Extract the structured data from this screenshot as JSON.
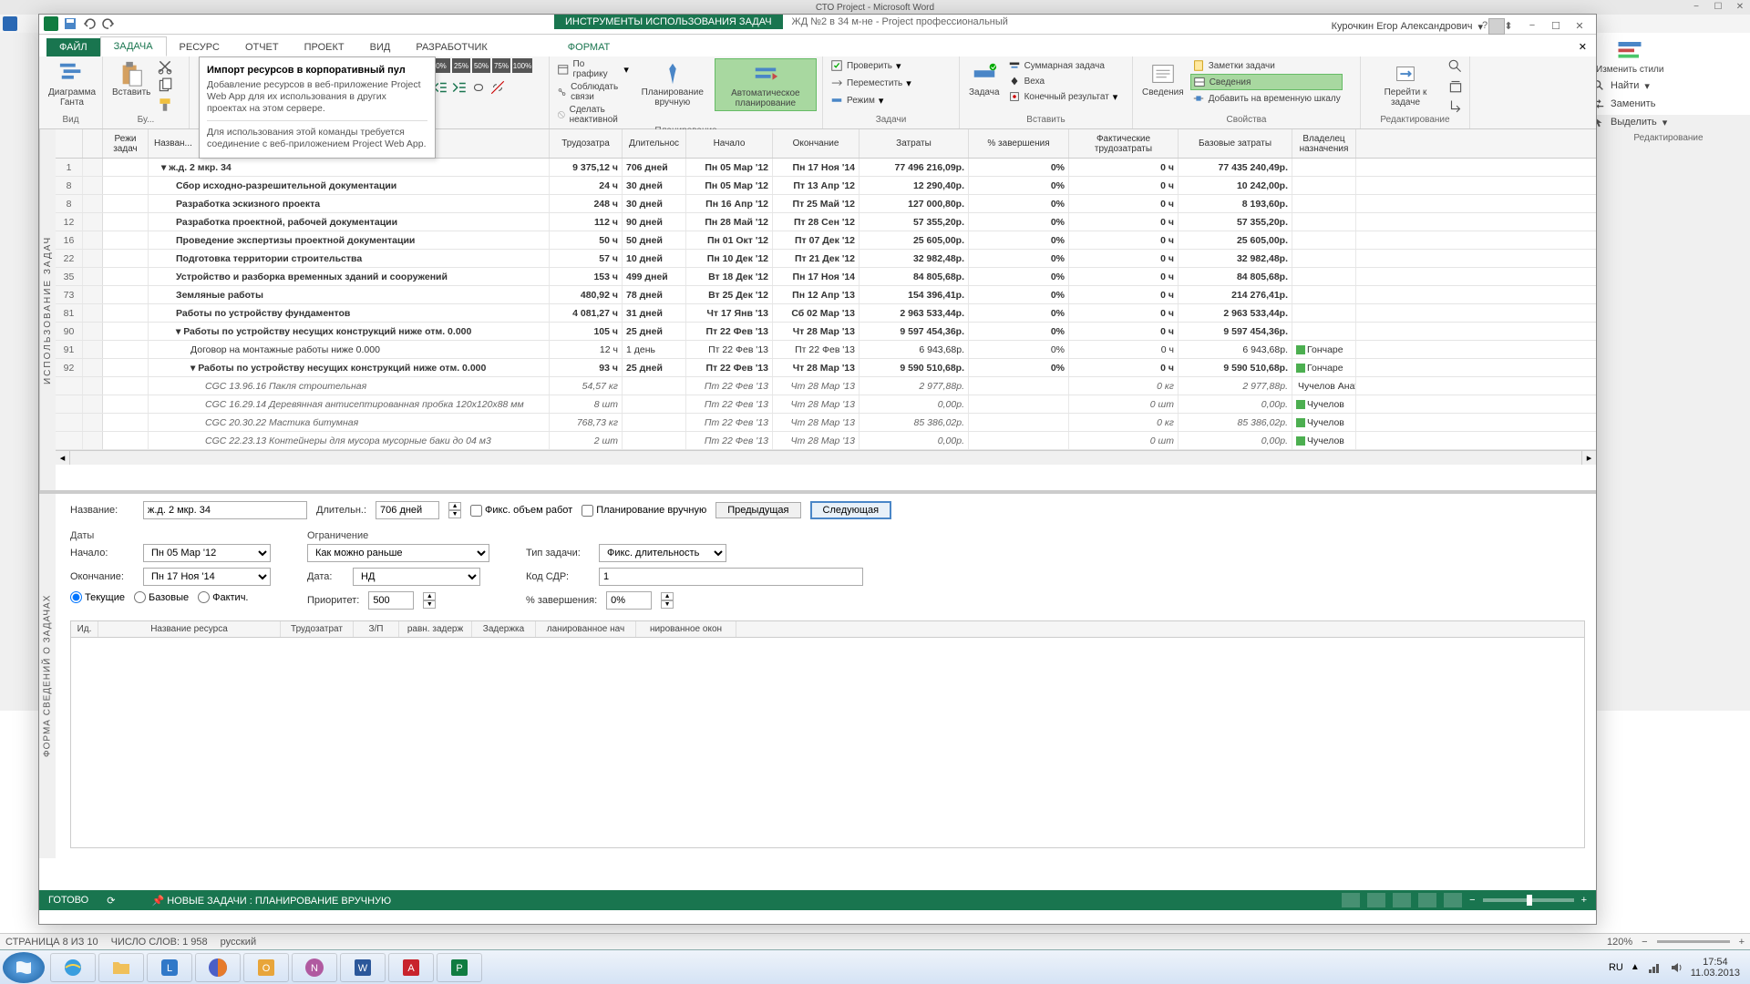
{
  "word": {
    "title": "СТО Project - Microsoft Word",
    "rail": {
      "find": "Найти",
      "replace": "Заменить",
      "select": "Выделить",
      "changeStyles": "Изменить стили",
      "group": "Редактирование"
    },
    "status": {
      "page": "СТРАНИЦА 8 ИЗ 10",
      "words": "ЧИСЛО СЛОВ: 1 958",
      "lang": "русский",
      "zoom": "120%"
    }
  },
  "project": {
    "toolTab": "ИНСТРУМЕНТЫ ИСПОЛЬЗОВАНИЯ ЗАДАЧ",
    "docTitle": "ЖД №2 в 34 м-не - Project профессиональный",
    "user": "Курочкин Егор Александрович",
    "tabs": {
      "file": "ФАЙЛ",
      "task": "ЗАДАЧА",
      "resource": "РЕСУРС",
      "report": "ОТЧЕТ",
      "projectTab": "ПРОЕКТ",
      "view": "ВИД",
      "developer": "РАЗРАБОТЧИК",
      "format": "ФОРМАТ"
    },
    "ribbon": {
      "view": {
        "gantt": "Диаграмма Ганта",
        "label": "Вид"
      },
      "clipboard": {
        "paste": "Вставить",
        "label": "Бу..."
      },
      "tooltip": {
        "title": "Импорт ресурсов в корпоративный пул",
        "body1": "Добавление ресурсов в веб-приложение Project Web App для их использования в других проектах на этом сервере.",
        "body2": "Для использования этой команды требуется соединение с веб-приложением Project Web App."
      },
      "percent": {
        "0": "0%",
        "25": "25%",
        "50": "50%",
        "75": "75%",
        "100": "100%"
      },
      "schedule": {
        "onTrack": "По графику",
        "respectLinks": "Соблюдать связи",
        "makeInactive": "Сделать неактивной",
        "label": "Планирование",
        "manual": "Планирование вручную",
        "auto": "Автоматическое планирование"
      },
      "tasks": {
        "inspect": "Проверить",
        "move": "Переместить",
        "mode": "Режим",
        "label": "Задачи",
        "task": "Задача"
      },
      "insert": {
        "summary": "Суммарная задача",
        "milestone": "Веха",
        "deliverable": "Конечный результат",
        "label": "Вставить"
      },
      "props": {
        "info": "Сведения",
        "notes": "Заметки задачи",
        "details": "Сведения",
        "timeline": "Добавить на временную шкалу",
        "label": "Свойства"
      },
      "edit": {
        "goto": "Перейти к задаче",
        "label": "Редактирование"
      }
    },
    "columns": {
      "rowMode": "Режи задач",
      "name": "Назван...",
      "work": "Трудозатра",
      "duration": "Длительнос",
      "start": "Начало",
      "finish": "Окончание",
      "cost": "Затраты",
      "pctComplete": "% завершения",
      "actualWork": "Фактические трудозатраты",
      "baselineCost": "Базовые затраты",
      "owner": "Владелец назначения"
    },
    "rows": [
      {
        "n": "1",
        "name": "ж.д. 2 мкр. 34",
        "work": "9 375,12 ч",
        "dur": "706 дней",
        "s": "Пн 05 Мар '12",
        "f": "Пн 17 Ноя '14",
        "cost": "77 496 216,09р.",
        "pct": "0%",
        "aw": "0 ч",
        "bc": "77 435 240,49р.",
        "bold": true,
        "lvl": 0,
        "exp": true
      },
      {
        "n": "8",
        "name": "Сбор исходно-разрешительной документации",
        "work": "24 ч",
        "dur": "30 дней",
        "s": "Пн 05 Мар '12",
        "f": "Пт 13 Апр '12",
        "cost": "12 290,40р.",
        "pct": "0%",
        "aw": "0 ч",
        "bc": "10 242,00р.",
        "bold": true,
        "lvl": 1
      },
      {
        "n": "8",
        "name": "Разработка эскизного проекта",
        "work": "248 ч",
        "dur": "30 дней",
        "s": "Пн 16 Апр '12",
        "f": "Пт 25 Май '12",
        "cost": "127 000,80р.",
        "pct": "0%",
        "aw": "0 ч",
        "bc": "8 193,60р.",
        "bold": true,
        "lvl": 1
      },
      {
        "n": "12",
        "name": "Разработка проектной, рабочей документации",
        "work": "112 ч",
        "dur": "90 дней",
        "s": "Пн 28 Май '12",
        "f": "Пт 28 Сен '12",
        "cost": "57 355,20р.",
        "pct": "0%",
        "aw": "0 ч",
        "bc": "57 355,20р.",
        "bold": true,
        "lvl": 1
      },
      {
        "n": "16",
        "name": "Проведение экспертизы проектной документации",
        "work": "50 ч",
        "dur": "50 дней",
        "s": "Пн 01 Окт '12",
        "f": "Пт 07 Дек '12",
        "cost": "25 605,00р.",
        "pct": "0%",
        "aw": "0 ч",
        "bc": "25 605,00р.",
        "bold": true,
        "lvl": 1
      },
      {
        "n": "22",
        "name": "Подготовка территории строительства",
        "work": "57 ч",
        "dur": "10 дней",
        "s": "Пн 10 Дек '12",
        "f": "Пт 21 Дек '12",
        "cost": "32 982,48р.",
        "pct": "0%",
        "aw": "0 ч",
        "bc": "32 982,48р.",
        "bold": true,
        "lvl": 1
      },
      {
        "n": "35",
        "name": "Устройство и разборка временных зданий и сооружений",
        "work": "153 ч",
        "dur": "499 дней",
        "s": "Вт 18 Дек '12",
        "f": "Пн 17 Ноя '14",
        "cost": "84 805,68р.",
        "pct": "0%",
        "aw": "0 ч",
        "bc": "84 805,68р.",
        "bold": true,
        "lvl": 1
      },
      {
        "n": "73",
        "name": "Земляные работы",
        "work": "480,92 ч",
        "dur": "78 дней",
        "s": "Вт 25 Дек '12",
        "f": "Пн 12 Апр '13",
        "cost": "154 396,41р.",
        "pct": "0%",
        "aw": "0 ч",
        "bc": "214 276,41р.",
        "bold": true,
        "lvl": 1
      },
      {
        "n": "81",
        "name": "Работы по устройству фундаментов",
        "work": "4 081,27 ч",
        "dur": "31 дней",
        "s": "Чт 17 Янв '13",
        "f": "Сб 02 Мар '13",
        "cost": "2 963 533,44р.",
        "pct": "0%",
        "aw": "0 ч",
        "bc": "2 963 533,44р.",
        "bold": true,
        "lvl": 1
      },
      {
        "n": "90",
        "name": "Работы по устройству несущих конструкций ниже отм. 0.000",
        "work": "105 ч",
        "dur": "25 дней",
        "s": "Пт 22 Фев '13",
        "f": "Чт 28 Мар '13",
        "cost": "9 597 454,36р.",
        "pct": "0%",
        "aw": "0 ч",
        "bc": "9 597 454,36р.",
        "bold": true,
        "lvl": 1,
        "exp": true
      },
      {
        "n": "91",
        "name": "Договор на монтажные работы ниже 0.000",
        "work": "12 ч",
        "dur": "1 день",
        "s": "Пт 22 Фев '13",
        "f": "Пт 22 Фев '13",
        "cost": "6 943,68р.",
        "pct": "0%",
        "aw": "0 ч",
        "bc": "6 943,68р.",
        "lvl": 2,
        "own": "Гончаре"
      },
      {
        "n": "92",
        "name": "Работы по устройству несущих конструкций ниже отм. 0.000",
        "work": "93 ч",
        "dur": "25 дней",
        "s": "Пт 22 Фев '13",
        "f": "Чт 28 Мар '13",
        "cost": "9 590 510,68р.",
        "pct": "0%",
        "aw": "0 ч",
        "bc": "9 590 510,68р.",
        "bold": true,
        "lvl": 2,
        "exp": true,
        "own": "Гончаре"
      },
      {
        "n": "",
        "name": "CGC 13.96.16 Пакля строительная",
        "work": "54,57 кг",
        "dur": "",
        "s": "Пт 22 Фев '13",
        "f": "Чт 28 Мар '13",
        "cost": "2 977,88р.",
        "pct": "",
        "aw": "0 кг",
        "bc": "2 977,88р.",
        "ital": true,
        "lvl": 3,
        "own": "Чучелов Анатоли"
      },
      {
        "n": "",
        "name": "CGC 16.29.14 Деревянная антисептированная пробка 120х120х88 мм",
        "work": "8 шт",
        "dur": "",
        "s": "Пт 22 Фев '13",
        "f": "Чт 28 Мар '13",
        "cost": "0,00р.",
        "pct": "",
        "aw": "0 шт",
        "bc": "0,00р.",
        "ital": true,
        "lvl": 3,
        "own": "Чучелов"
      },
      {
        "n": "",
        "name": "CGC 20.30.22 Мастика битумная",
        "work": "768,73 кг",
        "dur": "",
        "s": "Пт 22 Фев '13",
        "f": "Чт 28 Мар '13",
        "cost": "85 386,02р.",
        "pct": "",
        "aw": "0 кг",
        "bc": "85 386,02р.",
        "ital": true,
        "lvl": 3,
        "own": "Чучелов"
      },
      {
        "n": "",
        "name": "CGC 22.23.13 Контейнеры для мусора мусорные баки до 04 м3",
        "work": "2 шт",
        "dur": "",
        "s": "Пт 22 Фев '13",
        "f": "Чт 28 Мар '13",
        "cost": "0,00р.",
        "pct": "",
        "aw": "0 шт",
        "bc": "0,00р.",
        "ital": true,
        "lvl": 3,
        "own": "Чучелов"
      }
    ],
    "sideLabel": "ИСПОЛЬЗОВАНИЕ ЗАДАЧ",
    "form": {
      "sideLabel": "ФОРМА СВЕДЕНИЙ О ЗАДАЧАХ",
      "nameLabel": "Название:",
      "nameVal": "ж.д. 2 мкр. 34",
      "durLabel": "Длительн.:",
      "durVal": "706 дней",
      "fixedWork": "Фикс. объем работ",
      "manual": "Планирование вручную",
      "prev": "Предыдущая",
      "next": "Следующая",
      "datesLabel": "Даты",
      "startLabel": "Начало:",
      "startVal": "Пн 05 Мар '12",
      "finishLabel": "Окончание:",
      "finishVal": "Пн 17 Ноя '14",
      "constraintLabel": "Ограничение",
      "constraintType": "Как можно раньше",
      "dateLabel": "Дата:",
      "dateVal": "НД",
      "taskTypeLabel": "Тип задачи:",
      "taskTypeVal": "Фикс. длительность",
      "wbsLabel": "Код СДР:",
      "wbsVal": "1",
      "current": "Текущие",
      "baseline": "Базовые",
      "actual": "Фактич.",
      "priorityLabel": "Приоритет:",
      "priorityVal": "500",
      "pctLabel": "% завершения:",
      "pctVal": "0%",
      "gridCols": {
        "id": "Ид.",
        "resName": "Название ресурса",
        "work": "Трудозатрат",
        "ovt": "З/П",
        "leveling": "равн. задерж",
        "delay": "Задержка",
        "schedStart": "ланированное нач",
        "schedFinish": "нированное окон"
      }
    },
    "status": {
      "ready": "ГОТОВО",
      "newTasks": "НОВЫЕ ЗАДАЧИ : ПЛАНИРОВАНИЕ ВРУЧНУЮ"
    }
  },
  "taskbar": {
    "lang": "RU",
    "time": "17:54",
    "date": "11.03.2013"
  }
}
